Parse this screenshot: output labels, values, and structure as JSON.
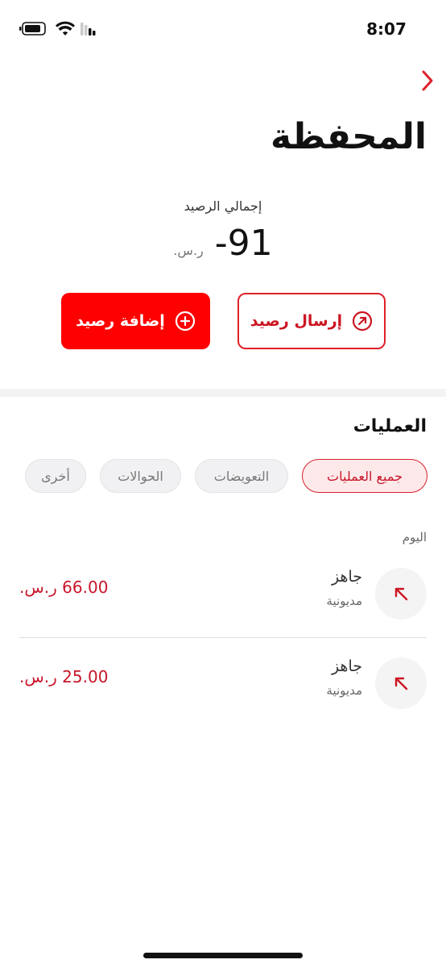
{
  "status_bar": {
    "time": "8:07"
  },
  "header": {
    "title": "المحفظة"
  },
  "balance": {
    "label": "إجمالي الرصيد",
    "value": "-91",
    "currency": "ر.س."
  },
  "actions": {
    "send_label": "إرسال رصيد",
    "add_label": "إضافة رصيد"
  },
  "operations": {
    "title": "العمليات",
    "filters": [
      {
        "label": "جميع العمليات",
        "active": true
      },
      {
        "label": "التعويضات",
        "active": false
      },
      {
        "label": "الحوالات",
        "active": false
      },
      {
        "label": "أخرى",
        "active": false
      }
    ],
    "date_group": "اليوم",
    "transactions": [
      {
        "title": "جاهز",
        "subtitle": "مديونية",
        "amount": "66.00 ر.س."
      },
      {
        "title": "جاهز",
        "subtitle": "مديونية",
        "amount": "25.00 ر.س."
      }
    ]
  },
  "colors": {
    "accent": "#ff0000",
    "accent_text": "#c8162a",
    "chip_active_bg": "#fde9ea"
  },
  "icons": {
    "back": "chevron-right-icon",
    "send": "arrow-up-right-circle-icon",
    "add": "plus-circle-icon",
    "transaction": "arrow-up-left-icon"
  }
}
